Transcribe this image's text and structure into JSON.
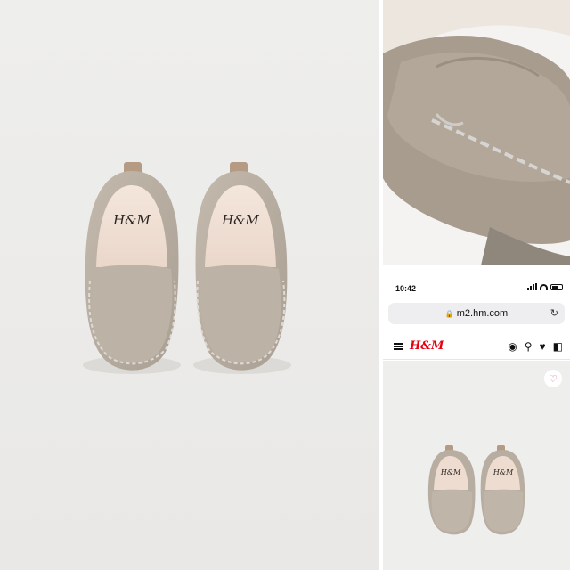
{
  "collage": {
    "main_photo": {
      "brand_imprint": "H&M"
    },
    "closeup_photo": {},
    "phone_screenshot": {
      "status": {
        "time": "10:42"
      },
      "browser": {
        "url": "m2.hm.com",
        "lock_icon": "lock-icon",
        "reload_icon": "reload-icon"
      },
      "site_header": {
        "brand": "H&M",
        "icons": [
          "menu-icon",
          "account-icon",
          "search-icon",
          "heart-icon",
          "bag-icon"
        ]
      },
      "product": {
        "brand_imprint": "H&M",
        "favorite_icon": "heart-outline-icon"
      }
    }
  },
  "colors": {
    "suede": "#b9aea2",
    "brand_red": "#e50010",
    "background": "#eeeeed"
  }
}
